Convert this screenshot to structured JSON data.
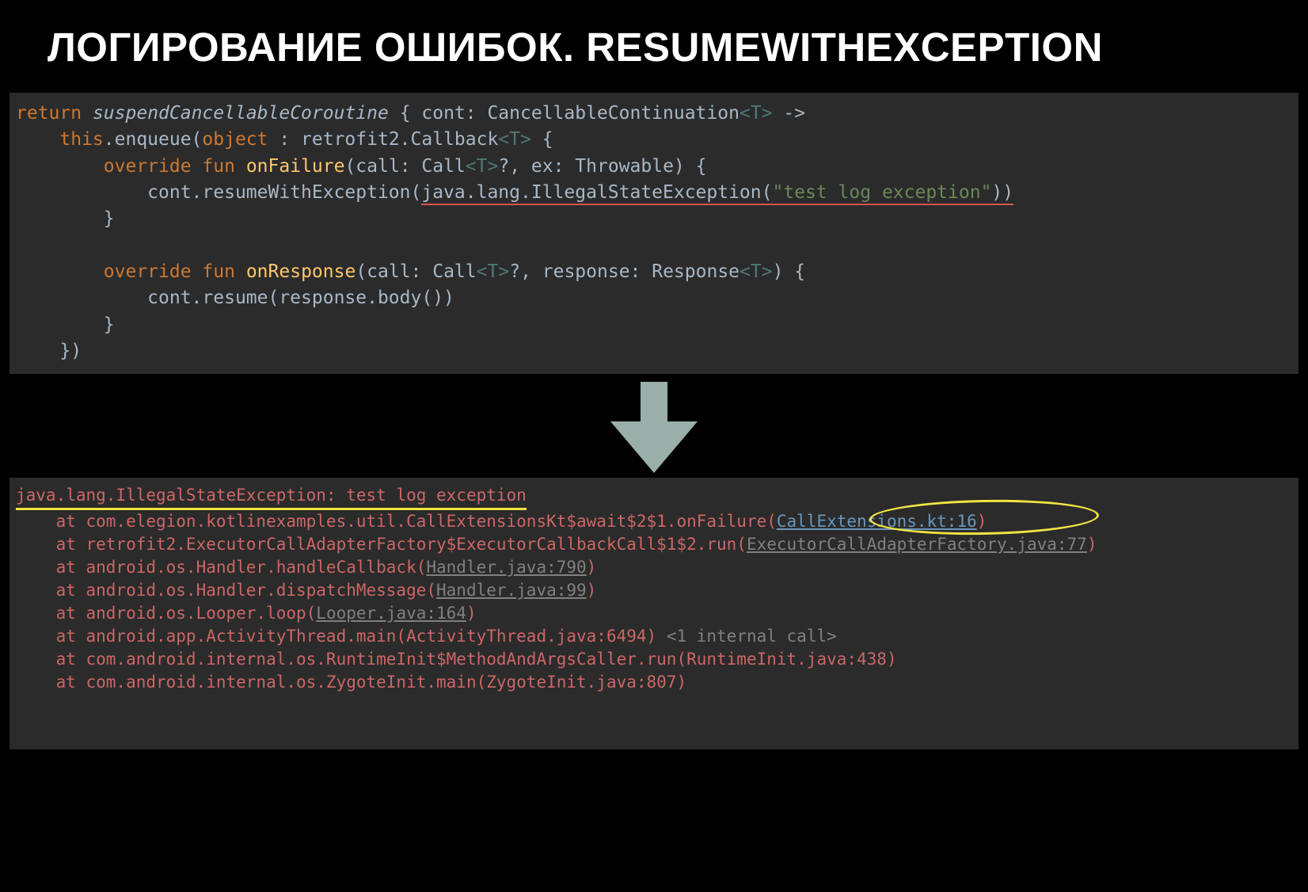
{
  "title": "ЛОГИРОВАНИЕ ОШИБОК. RESUMEWITHEXCEPTION",
  "code": {
    "kw_return": "return",
    "suspend": "suspendCancellableCoroutine",
    "lbrace_cont": "{ cont: CancellableContinuation",
    "open_T": "<",
    "T": "T",
    "close_T": ">",
    "arrow": " ->",
    "kw_this": "this",
    "dot_enqueue": ".enqueue(",
    "kw_object": "object",
    "colon_callback": " : retrofit2.Callback",
    "lbrace2": " {",
    "kw_override": "override",
    "kw_fun": "fun",
    "onFailure": "onFailure",
    "onFailure_params_open": "(call: Call",
    "q_comma_ex": "?, ex: Throwable) {",
    "cont_resumeEx": "cont.resumeWithException(",
    "java_ise": "java.lang.IllegalStateException(",
    "str_msg": "\"test log exception\"",
    "close_paren2": "))",
    "rbrace": "}",
    "onResponse": "onResponse",
    "onResponse_params_open": "(call: Call",
    "q_resp": "?, response: Response",
    "close_resp": ") {",
    "cont_resume": "cont.resume(response.body())",
    "close_enq": "})"
  },
  "log": {
    "head": "java.lang.IllegalStateException: test log exception",
    "l1_pre": "    at com.elegion.kotlinexamples.util.CallExtensionsKt$await$2$1.onFailure(",
    "l1_link": "CallExtensions.kt:16",
    "l1_post": ")",
    "l2_pre": "    at retrofit2.ExecutorCallAdapterFactory$ExecutorCallbackCall$1$2.run(",
    "l2_link": "ExecutorCallAdapterFactory.java:77",
    "l2_post": ")",
    "l3_pre": "    at android.os.Handler.handleCallback(",
    "l3_link": "Handler.java:790",
    "l3_post": ")",
    "l4_pre": "    at android.os.Handler.dispatchMessage(",
    "l4_link": "Handler.java:99",
    "l4_post": ")",
    "l5_pre": "    at android.os.Looper.loop(",
    "l5_link": "Looper.java:164",
    "l5_post": ")",
    "l6_pre": "    at android.app.ActivityThread.main(ActivityThread.java:6494) ",
    "l6_hint": "<1 internal call>",
    "l7": "    at com.android.internal.os.RuntimeInit$MethodAndArgsCaller.run(RuntimeInit.java:438)",
    "l8": "    at com.android.internal.os.ZygoteInit.main(ZygoteInit.java:807)"
  }
}
